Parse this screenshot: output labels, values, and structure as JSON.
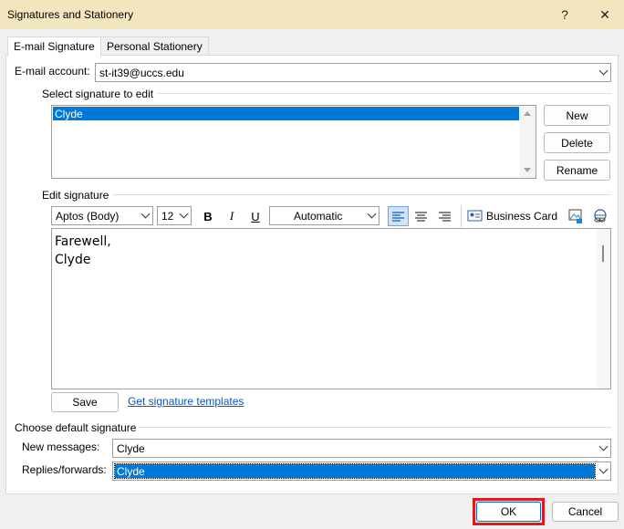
{
  "window": {
    "title": "Signatures and Stationery",
    "help": "?",
    "close": "✕"
  },
  "tabs": [
    {
      "label": "E-mail Signature"
    },
    {
      "label": "Personal Stationery"
    }
  ],
  "email_account": {
    "label": "E-mail account:",
    "value": "st-it39@uccs.edu"
  },
  "select_signature": {
    "label": "Select signature to edit",
    "items": [
      {
        "label": "Clyde",
        "selected": true
      }
    ]
  },
  "sig_buttons": {
    "new": "New",
    "delete": "Delete",
    "rename": "Rename"
  },
  "edit_signature": {
    "label": "Edit signature",
    "font": "Aptos (Body)",
    "size": "12",
    "bold": "B",
    "italic": "I",
    "underline": "U",
    "color": "Automatic",
    "business_card": "Business Card",
    "body_lines": [
      "Farewell,",
      "Clyde"
    ]
  },
  "save_label": "Save",
  "templates_link": "Get signature templates",
  "default_signature": {
    "label": "Choose default signature",
    "new_messages_label": "New messages:",
    "new_messages_value": "Clyde",
    "replies_label": "Replies/forwards:",
    "replies_value": "Clyde"
  },
  "footer": {
    "ok": "OK",
    "cancel": "Cancel"
  },
  "colors": {
    "titlebar": "#f2e6bf",
    "selection": "#0078d7",
    "highlight_box": "#e0191f"
  }
}
